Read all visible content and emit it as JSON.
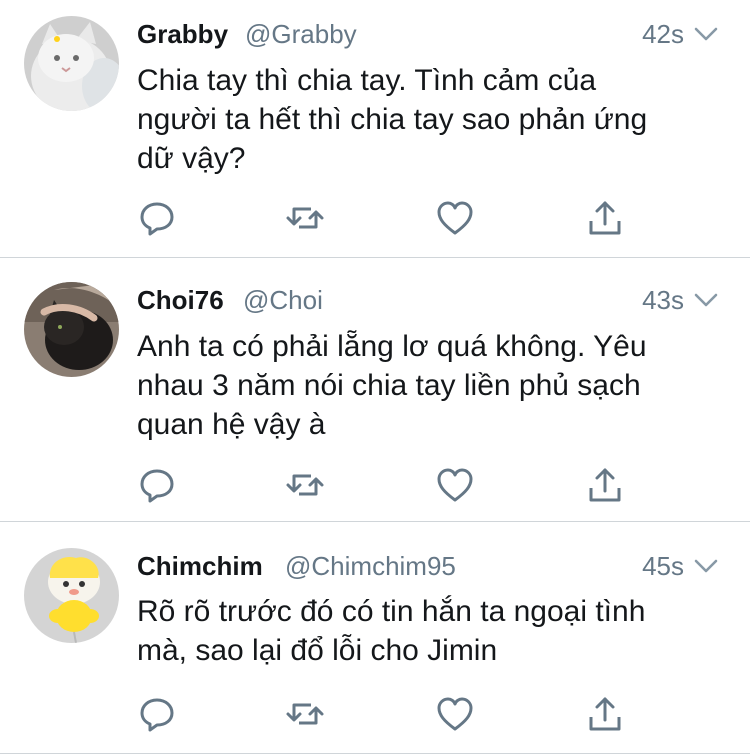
{
  "tweets": [
    {
      "name": "Grabby",
      "handle": "@Grabby",
      "time": "42s",
      "text": "Chia tay thì chia tay. Tình cảm của\nngười ta hết thì chia tay sao phản ứng\ndữ vậy?",
      "avatar": "white-cat-photo"
    },
    {
      "name": "Choi76",
      "handle": "@Choi",
      "time": "43s",
      "text": "Anh ta có phải lẵng lơ quá không. Yêu\nnhau 3 năm nói chia tay liền phủ sạch\nquan hệ vậy à",
      "avatar": "black-cat-photo"
    },
    {
      "name": "Chimchim",
      "handle": "@Chimchim95",
      "time": "45s",
      "text": "Rõ rõ trước đó có tin hắn ta ngoại tình\nmà, sao lại đổ lỗi cho Jimin",
      "avatar": "yellow-character-plush"
    }
  ],
  "action_icons": [
    "reply-icon",
    "retweet-icon",
    "like-icon",
    "share-icon"
  ],
  "colors": {
    "name": "#14171a",
    "secondary": "#657786",
    "icon": "#657786",
    "divider": "#d0d5d9",
    "background": "#ffffff"
  }
}
